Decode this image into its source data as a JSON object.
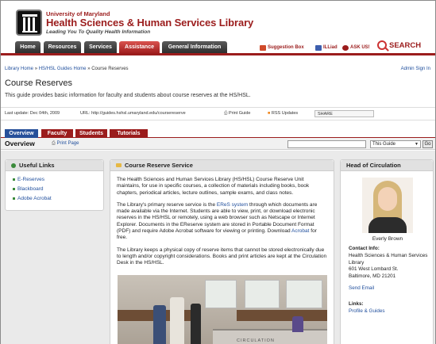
{
  "header": {
    "university": "University of Maryland",
    "library_name": "Health Sciences & Human Services Library",
    "tagline": "Leading You To Quality Health Information",
    "nav": [
      "Home",
      "Resources",
      "Services",
      "Assistance",
      "General Information"
    ],
    "utilities": {
      "suggestion": "Suggestion Box",
      "illiad": "ILLiad",
      "askus": "ASK US!",
      "search": "SEARCH"
    }
  },
  "breadcrumb": {
    "home": "Library Home",
    "sep1": "»",
    "guides": "HS/HSL Guides Home",
    "sep2": "»",
    "current": "Course Reserves"
  },
  "admin_link": "Admin Sign In",
  "page": {
    "title": "Course Reserves",
    "description": "This guide provides basic information for faculty and students about course reserves at the HS/HSL."
  },
  "meta": {
    "last_update": "Last update: Dec 04th, 2009",
    "url": "URL: http://guides.hshsl.umaryland.edu/coursereserve",
    "print_guide": "Print Guide",
    "rss": "RSS Updates",
    "share": "SHARE"
  },
  "tabs": [
    "Overview",
    "Faculty",
    "Students",
    "Tutorials"
  ],
  "overview_bar": {
    "heading": "Overview",
    "print_page": "Print Page",
    "search_scope": "This Guide",
    "go": "Go"
  },
  "useful_links": {
    "title": "Useful Links",
    "items": [
      "E-Reserves",
      "Blackboard",
      "Adobe Acrobat"
    ]
  },
  "reserve_service": {
    "title": "Course Reserve Service",
    "p1": "The Health Sciences and Human Services Library (HS/HSL) Course Reserve Unit maintains, for use in specific courses, a collection of materials including books, book chapters, periodical articles, lecture outlines, sample exams, and class notes.",
    "p2_a": "The Library's primary reserve service is the ",
    "p2_link": "EReS system",
    "p2_b": " through which documents are made available via the Internet. Students are able to view, print, or download electronic reserves in the HS/HSL or remotely, using a web browser such as Netscape or Internet Explorer. Documents in the EReserve system are stored in Portable Document Format (PDF) and require Adobe Acrobat software for viewing or printing. Download ",
    "p2_link2": "Acrobat",
    "p2_c": " for free.",
    "p3": "The Library keeps a physical copy of reserve items that cannot be stored electronically due to length and/or copyright considerations. Books and print articles are kept at the Circulation Desk in the HS/HSL.",
    "photo_label": "CIRCULATION"
  },
  "head_circ": {
    "title": "Head of Circulation",
    "name": "Everly Brown",
    "contact_label": "Contact Info:",
    "address": [
      "Health Sciences & Human Services",
      "Library",
      "601 West Lombard St.",
      "Baltimore, MD 21201"
    ],
    "send_email": "Send Email",
    "links_label": "Links:",
    "link": "Profile & Guides"
  },
  "colors": {
    "brand": "#9b1c1c",
    "active_nav": "#c9302c",
    "tab_active": "#27509a",
    "link": "#1f4e9c"
  }
}
